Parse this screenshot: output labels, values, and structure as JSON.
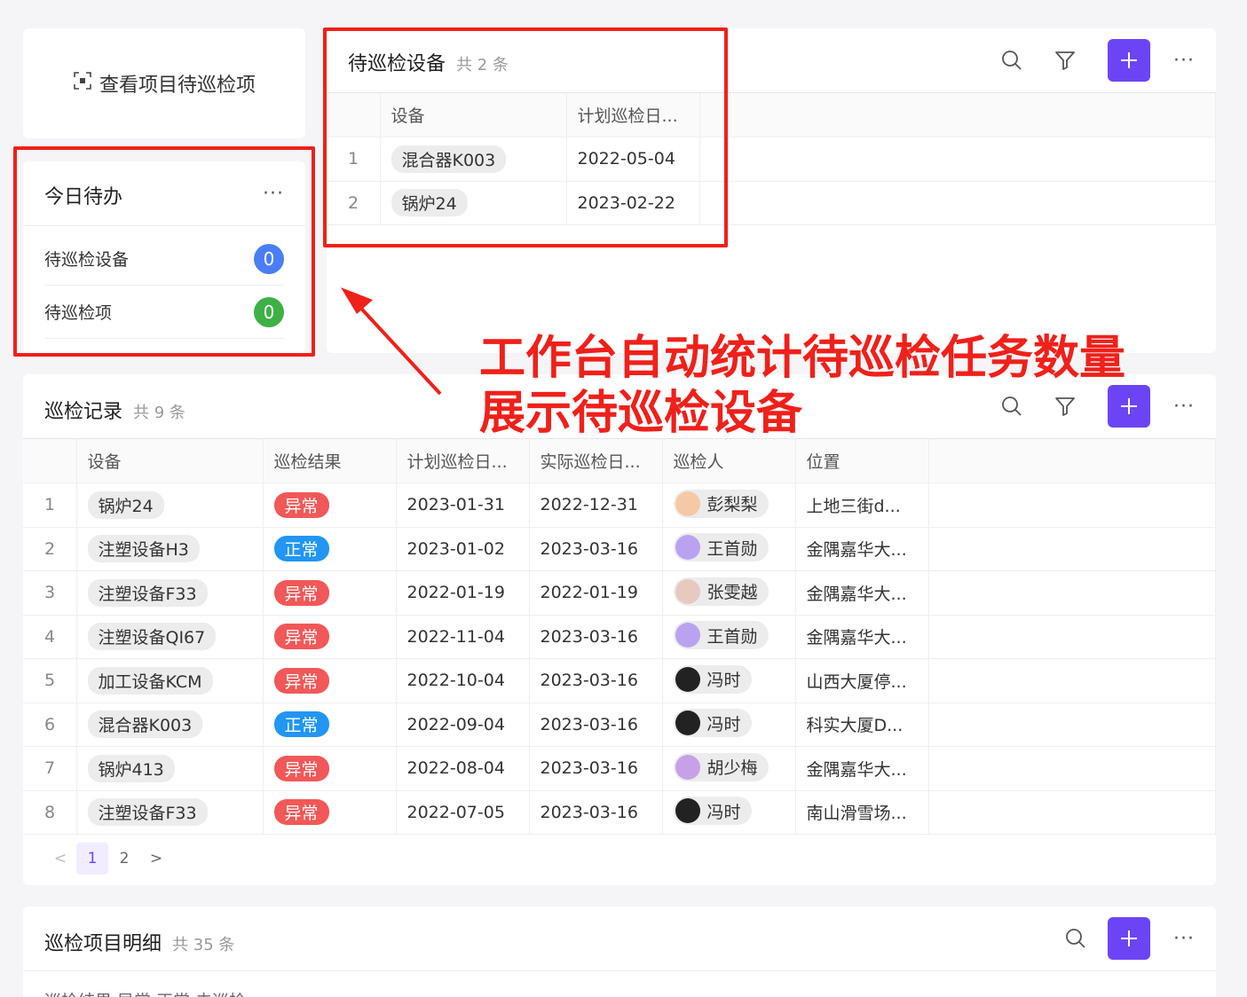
{
  "quick_entry": {
    "label": "查看项目待巡检项",
    "icon": "scan-icon"
  },
  "today_todo": {
    "title": "今日待办",
    "more": "···",
    "items": [
      {
        "label": "待巡检设备",
        "count": "0",
        "color": "#4a7ef6"
      },
      {
        "label": "待巡检项",
        "count": "0",
        "color": "#3db046"
      }
    ]
  },
  "pending_devices": {
    "title": "待巡检设备",
    "count_text": "共 2 条",
    "columns": [
      "设备",
      "计划巡检日..."
    ],
    "rows": [
      {
        "index": "1",
        "device": "混合器K003",
        "plan_date": "2022-05-04"
      },
      {
        "index": "2",
        "device": "锅炉24",
        "plan_date": "2023-02-22"
      }
    ]
  },
  "records": {
    "title": "巡检记录",
    "count_text": "共 9 条",
    "columns": [
      "设备",
      "巡检结果",
      "计划巡检日...",
      "实际巡检日...",
      "巡检人",
      "位置"
    ],
    "rows": [
      {
        "index": "1",
        "device": "锅炉24",
        "result": "异常",
        "result_type": "abn",
        "plan": "2023-01-31",
        "actual": "2022-12-31",
        "person": "彭梨梨",
        "avatar": "#f5c8a6",
        "location": "上地三街d..."
      },
      {
        "index": "2",
        "device": "注塑设备H3",
        "result": "正常",
        "result_type": "ok",
        "plan": "2023-01-02",
        "actual": "2023-03-16",
        "person": "王首勋",
        "avatar": "#b9a3f0",
        "location": "金隅嘉华大..."
      },
      {
        "index": "3",
        "device": "注塑设备F33",
        "result": "异常",
        "result_type": "abn",
        "plan": "2022-01-19",
        "actual": "2022-01-19",
        "person": "张雯越",
        "avatar": "#e7c9c0",
        "location": "金隅嘉华大..."
      },
      {
        "index": "4",
        "device": "注塑设备QI67",
        "result": "异常",
        "result_type": "abn",
        "plan": "2022-11-04",
        "actual": "2023-03-16",
        "person": "王首勋",
        "avatar": "#b9a3f0",
        "location": "金隅嘉华大..."
      },
      {
        "index": "5",
        "device": "加工设备KCM",
        "result": "异常",
        "result_type": "abn",
        "plan": "2022-10-04",
        "actual": "2023-03-16",
        "person": "冯时",
        "avatar": "#222222",
        "location": "山西大厦停..."
      },
      {
        "index": "6",
        "device": "混合器K003",
        "result": "正常",
        "result_type": "ok",
        "plan": "2022-09-04",
        "actual": "2023-03-16",
        "person": "冯时",
        "avatar": "#222222",
        "location": "科实大厦D..."
      },
      {
        "index": "7",
        "device": "锅炉413",
        "result": "异常",
        "result_type": "abn",
        "plan": "2022-08-04",
        "actual": "2023-03-16",
        "person": "胡少梅",
        "avatar": "#c8a0e8",
        "location": "金隅嘉华大..."
      },
      {
        "index": "8",
        "device": "注塑设备F33",
        "result": "异常",
        "result_type": "abn",
        "plan": "2022-07-05",
        "actual": "2023-03-16",
        "person": "冯时",
        "avatar": "#222222",
        "location": "南山滑雪场..."
      }
    ],
    "pager": {
      "prev": "<",
      "pages": [
        "1",
        "2"
      ],
      "active": "1",
      "next": ">"
    }
  },
  "details": {
    "title": "巡检项目明细",
    "count_text": "共 35 条",
    "filter_text": "巡检结果  异常  正常  未巡检"
  },
  "annotation": {
    "line1": "工作台自动统计待巡检任务数量",
    "line2": "展示待巡检设备",
    "color": "#f0201a"
  },
  "colors": {
    "accent": "#6b45f5",
    "abnormal": "#f25858",
    "normal": "#2196f3"
  }
}
